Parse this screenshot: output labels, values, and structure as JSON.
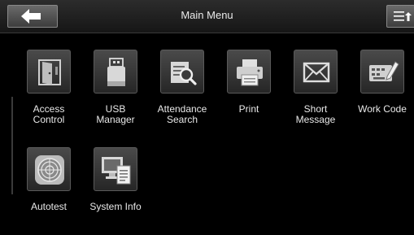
{
  "header": {
    "title": "Main Menu",
    "back_icon": "back-arrow-icon",
    "menu_icon": "list-sort-icon"
  },
  "menu": {
    "items": [
      {
        "label": "Access\nControl",
        "icon": "door-icon"
      },
      {
        "label": "USB\nManager",
        "icon": "usb-drive-icon"
      },
      {
        "label": "Attendance\nSearch",
        "icon": "document-search-icon"
      },
      {
        "label": "Print",
        "icon": "printer-icon"
      },
      {
        "label": "Short\nMessage",
        "icon": "envelope-icon"
      },
      {
        "label": "Work Code",
        "icon": "keyboard-edit-icon"
      },
      {
        "label": "Autotest",
        "icon": "target-icon"
      },
      {
        "label": "System Info",
        "icon": "system-info-icon"
      }
    ]
  }
}
